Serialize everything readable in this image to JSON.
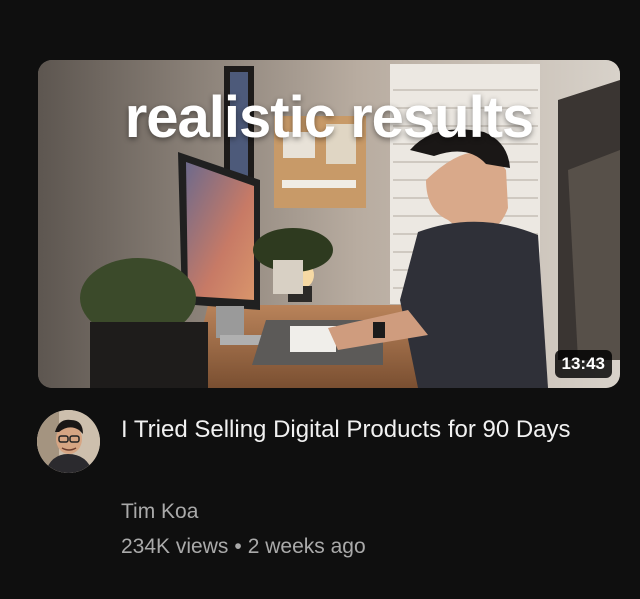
{
  "video": {
    "thumbnail_text": "realistic results",
    "duration": "13:43",
    "title": "I Tried Selling Digital Products for 90 Days",
    "channel": "Tim Koa",
    "views": "234K views",
    "separator": "•",
    "age": "2 weeks ago"
  },
  "colors": {
    "background": "#0f0f0f",
    "title": "#f1f1f1",
    "secondary_text": "#aaaaaa"
  }
}
